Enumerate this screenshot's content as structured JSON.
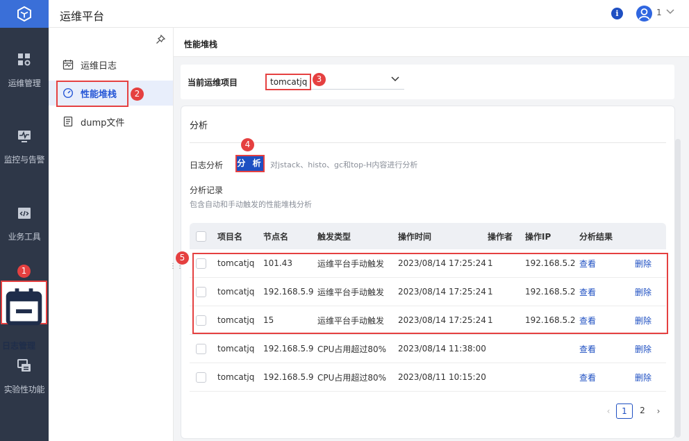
{
  "app": {
    "title": "运维平台"
  },
  "topbar": {
    "info_icon": "info-icon",
    "user_icon": "user-avatar-icon",
    "user_name": "1"
  },
  "leftnav": {
    "items": [
      {
        "label": "运维管理",
        "icon": "grid-settings-icon"
      },
      {
        "label": "监控与告警",
        "icon": "monitor-pulse-icon"
      },
      {
        "label": "业务工具",
        "icon": "code-window-icon"
      },
      {
        "label": "日志管理",
        "icon": "calendar-log-icon"
      },
      {
        "label": "实验性功能",
        "icon": "stacked-window-icon"
      }
    ]
  },
  "submenu": {
    "items": [
      {
        "label": "运维日志",
        "icon": "log-calendar-icon"
      },
      {
        "label": "性能堆栈",
        "icon": "gauge-icon"
      },
      {
        "label": "dump文件",
        "icon": "document-icon"
      }
    ]
  },
  "page": {
    "title": "性能堆栈"
  },
  "project": {
    "label": "当前运维项目",
    "value": "tomcatjq"
  },
  "analysis": {
    "title": "分析",
    "log_label": "日志分析",
    "button": "分 析",
    "hint": "对jstack、histo、gc和top-H内容进行分析",
    "records_title": "分析记录",
    "records_subtitle": "包含自动和手动触发的性能堆栈分析"
  },
  "table": {
    "headers": [
      "项目名",
      "节点名",
      "触发类型",
      "操作时间",
      "操作者",
      "操作IP",
      "分析结果"
    ],
    "rows": [
      {
        "project": "tomcatjq",
        "node": "101.43",
        "trigger": "运维平台手动触发",
        "time": "2023/08/14 17:25:24",
        "operator": "1",
        "ip": "192.168.5.2",
        "view": "查看",
        "delete": "删除"
      },
      {
        "project": "tomcatjq",
        "node": "192.168.5.9",
        "trigger": "运维平台手动触发",
        "time": "2023/08/14 17:25:24",
        "operator": "1",
        "ip": "192.168.5.2",
        "view": "查看",
        "delete": "删除"
      },
      {
        "project": "tomcatjq",
        "node": "15",
        "trigger": "运维平台手动触发",
        "time": "2023/08/14 17:25:24",
        "operator": "1",
        "ip": "192.168.5.2",
        "view": "查看",
        "delete": "删除"
      },
      {
        "project": "tomcatjq",
        "node": "192.168.5.9",
        "trigger": "CPU占用超过80%",
        "time": "2023/08/14 11:38:00",
        "operator": "",
        "ip": "",
        "view": "查看",
        "delete": "删除"
      },
      {
        "project": "tomcatjq",
        "node": "192.168.5.9",
        "trigger": "CPU占用超过80%",
        "time": "2023/08/11 10:15:20",
        "operator": "",
        "ip": "",
        "view": "查看",
        "delete": "删除"
      }
    ]
  },
  "pagination": {
    "pages": [
      "1",
      "2"
    ],
    "current": "1",
    "prev": "‹",
    "next": "›"
  },
  "markers": [
    "1",
    "2",
    "3",
    "4",
    "5"
  ],
  "colors": {
    "nav_bg": "#2e3748",
    "accent": "#1e4fc2",
    "callout": "#e54040"
  }
}
